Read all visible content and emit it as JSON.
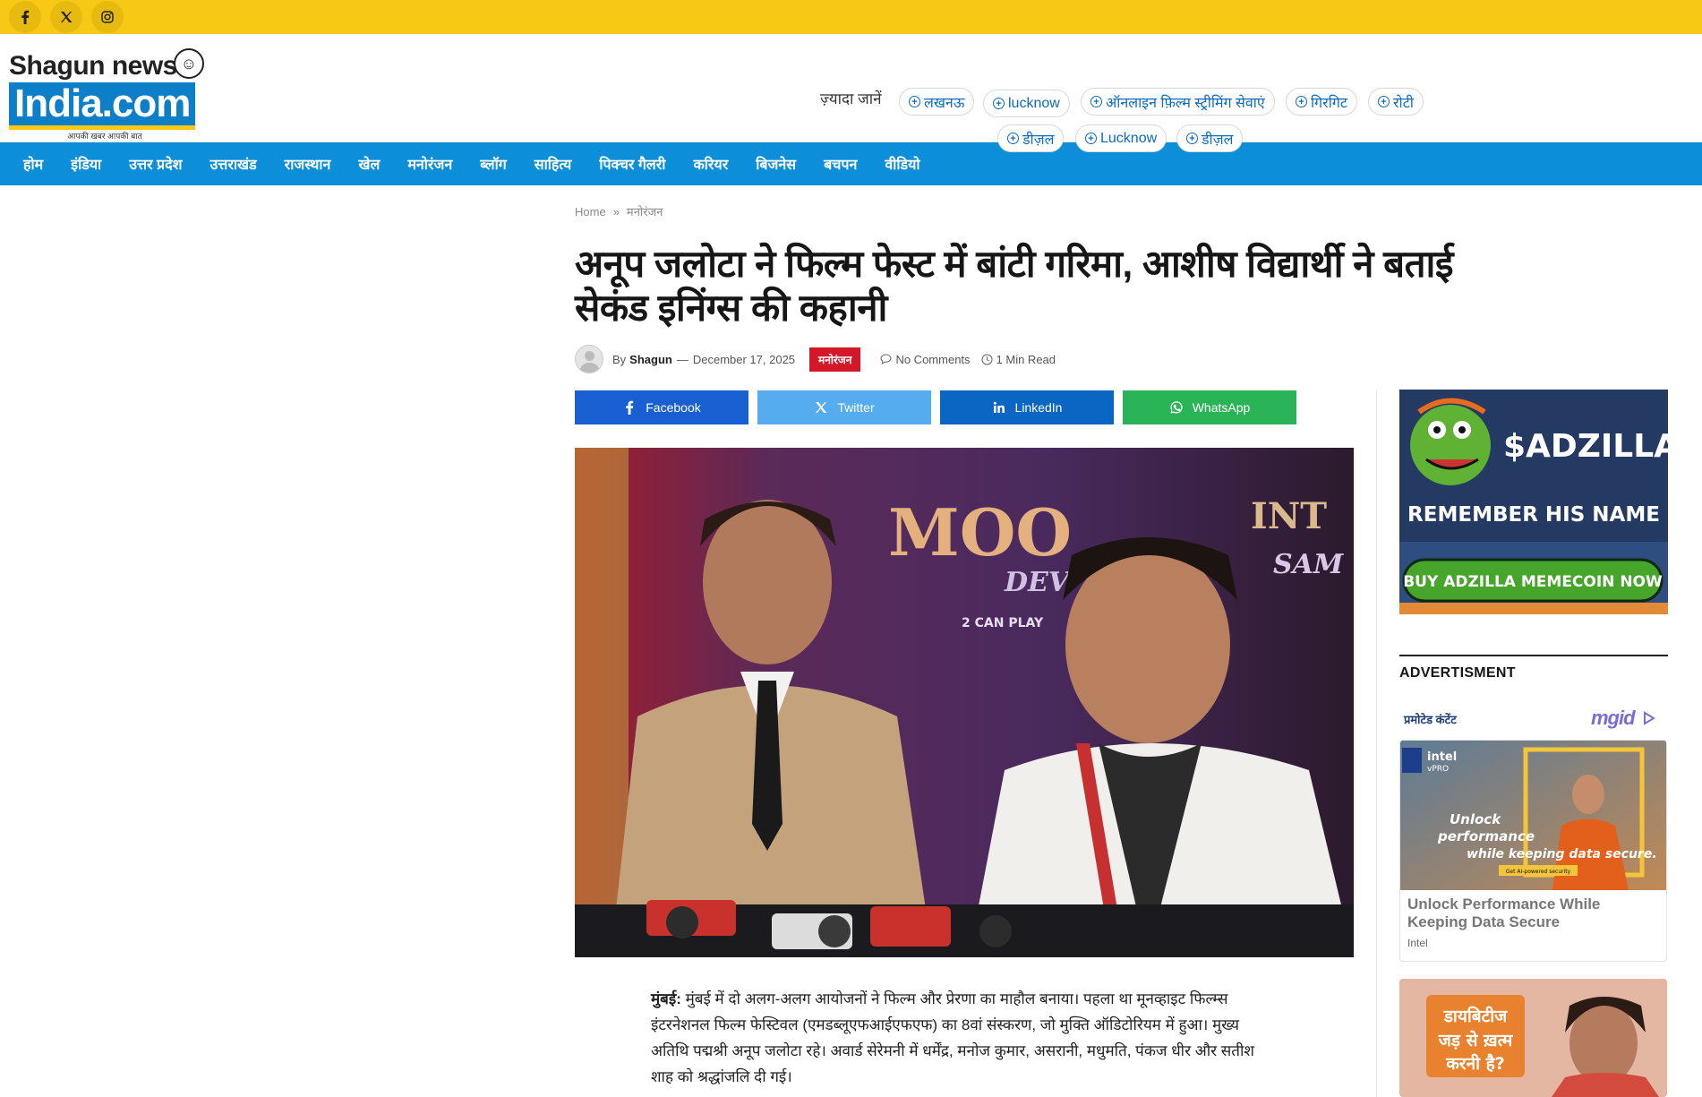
{
  "topbar": {
    "socials": [
      {
        "name": "facebook-icon",
        "glyph": "f"
      },
      {
        "name": "x-icon",
        "glyph": "x"
      },
      {
        "name": "instagram-icon",
        "glyph": "ig"
      }
    ]
  },
  "logo": {
    "line1": "Shagun news",
    "line2": "India.com",
    "tagline": "आपकी खबर आपकी बात"
  },
  "explore": {
    "label": "ज़्यादा जानें",
    "pills": [
      "लखनऊ",
      "lucknow",
      "ऑनलाइन फ़िल्म स्ट्रीमिंग सेवाएं",
      "गिरगिट",
      "रोटी",
      "डीज़ल",
      "Lucknow",
      "डीज़ल"
    ]
  },
  "nav": {
    "items": [
      "होम",
      "इंडिया",
      "उत्तर प्रदेश",
      "उत्तराखंड",
      "राजस्थान",
      "खेल",
      "मनोरंजन",
      "ब्लॉग",
      "साहित्य",
      "पिक्चर गैलरी",
      "करियर",
      "बिजनेस",
      "बचपन",
      "वीडियो"
    ]
  },
  "breadcrumb": {
    "home": "Home",
    "sep": "»",
    "current": "मनोरंजन"
  },
  "article": {
    "title": "अनूप जलोटा ने फिल्म फेस्ट में बांटी गरिमा, आशीष विद्यार्थी ने बताई सेकंड इनिंग्स की कहानी",
    "by": "By",
    "author": "Shagun",
    "dash": "—",
    "date": "December 17, 2025",
    "category": "मनोरंजन",
    "comments": "No Comments",
    "read_time": "1 Min Read",
    "city": "मुंबई:",
    "body": " मुंबई में दो अलग-अलग आयोजनों ने फिल्म और प्रेरणा का माहौल बनाया। पहला था मूनव्हाइट फिल्म्स इंटरनेशनल फिल्म फेस्टिवल (एमडब्लूएफआईएफएफ) का 8वां संस्करण, जो मुक्ति ऑडिटोरियम में हुआ। मुख्य अतिथि पद्मश्री अनूप जलोटा रहे। अवार्ड सेरेमनी में धर्मेंद्र, मनोज कुमार, असरानी, मधुमति, पंकज धीर और सतीश शाह को श्रद्धांजलि दी गई।"
  },
  "share": {
    "buttons": [
      {
        "label": "Facebook",
        "color": "#1a5fd1"
      },
      {
        "label": "Twitter",
        "color": "#55acee"
      },
      {
        "label": "LinkedIn",
        "color": "#0a66c2"
      },
      {
        "label": "WhatsApp",
        "color": "#2ab457"
      }
    ]
  },
  "hero": {
    "backdrop_text_1": "MOO",
    "backdrop_text_2": "INT",
    "backdrop_text_3": "DEV",
    "backdrop_text_4": "2 CAN PLAY",
    "backdrop_text_5": "SAM"
  },
  "sidebar": {
    "ad_top": {
      "brand": "$ADZILLA",
      "headline": "REMEMBER HIS NAME",
      "cta": "BUY ADZILLA MEMECOIN NOW"
    },
    "advertisement_label": "ADVERTISMENT",
    "promoted_label": "प्रमोटेड कंटेंट",
    "mgid": "mgid",
    "card": {
      "brand_line1": "intel",
      "brand_line2": "vPRO",
      "overlay_l1": "Unlock",
      "overlay_l2": "performance",
      "overlay_l3": "while keeping data secure.",
      "overlay_badge": "Get AI-powered security",
      "title": "Unlock Performance While Keeping Data Secure",
      "source": "Intel"
    },
    "card2": {
      "text_l1": "डायबिटीज",
      "text_l2": "जड़ से ख़त्म",
      "text_l3": "करनी है?"
    }
  },
  "colors": {
    "topbar": "#f7c815",
    "nav": "#0d8ed8",
    "category_badge": "#d3182a",
    "link": "#0b6bc2"
  }
}
